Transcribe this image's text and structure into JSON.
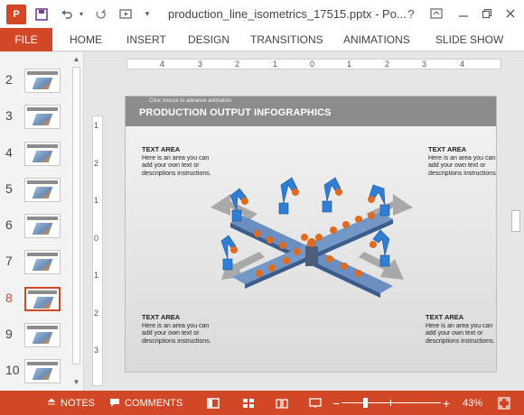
{
  "window": {
    "title": "production_line_isometrics_17515.pptx - Po...",
    "help_label": "?"
  },
  "ribbon": {
    "file_label": "FILE",
    "tabs": [
      "HOME",
      "INSERT",
      "DESIGN",
      "TRANSITIONS",
      "ANIMATIONS",
      "SLIDE SHOW"
    ]
  },
  "thumbnails": [
    {
      "num": "2",
      "active": false
    },
    {
      "num": "3",
      "active": false
    },
    {
      "num": "4",
      "active": false
    },
    {
      "num": "5",
      "active": false
    },
    {
      "num": "6",
      "active": false
    },
    {
      "num": "7",
      "active": false
    },
    {
      "num": "8",
      "active": true
    },
    {
      "num": "9",
      "active": false
    },
    {
      "num": "10",
      "active": false
    }
  ],
  "ruler": {
    "horizontal": [
      "4",
      "3",
      "2",
      "1",
      "0",
      "1",
      "2",
      "3",
      "4"
    ],
    "vertical": [
      "1",
      "2",
      "1",
      "0",
      "1",
      "2",
      "3"
    ]
  },
  "slide": {
    "hint": "Click mouse to advance animation.",
    "title": "PRODUCTION OUTPUT INFOGRAPHICS",
    "blocks": [
      {
        "heading": "TEXT AREA",
        "body": "Here is an area you can add your own text or descriptions instructions."
      },
      {
        "heading": "TEXT AREA",
        "body": "Here is an area you can add your own text or descriptions instructions."
      },
      {
        "heading": "TEXT AREA",
        "body": "Here is an area you can add your own text or descriptions instructions."
      },
      {
        "heading": "TEXT AREA",
        "body": "Here is an area you can add your own text or descriptions instructions."
      }
    ]
  },
  "statusbar": {
    "notes_label": "NOTES",
    "comments_label": "COMMENTS",
    "zoom_minus": "−",
    "zoom_plus": "+",
    "zoom_percent": "43%"
  },
  "colors": {
    "accent": "#d24726",
    "slide_header": "#8c8c8c",
    "robot_blue": "#2f7fd6",
    "box_orange": "#e06a1e"
  }
}
